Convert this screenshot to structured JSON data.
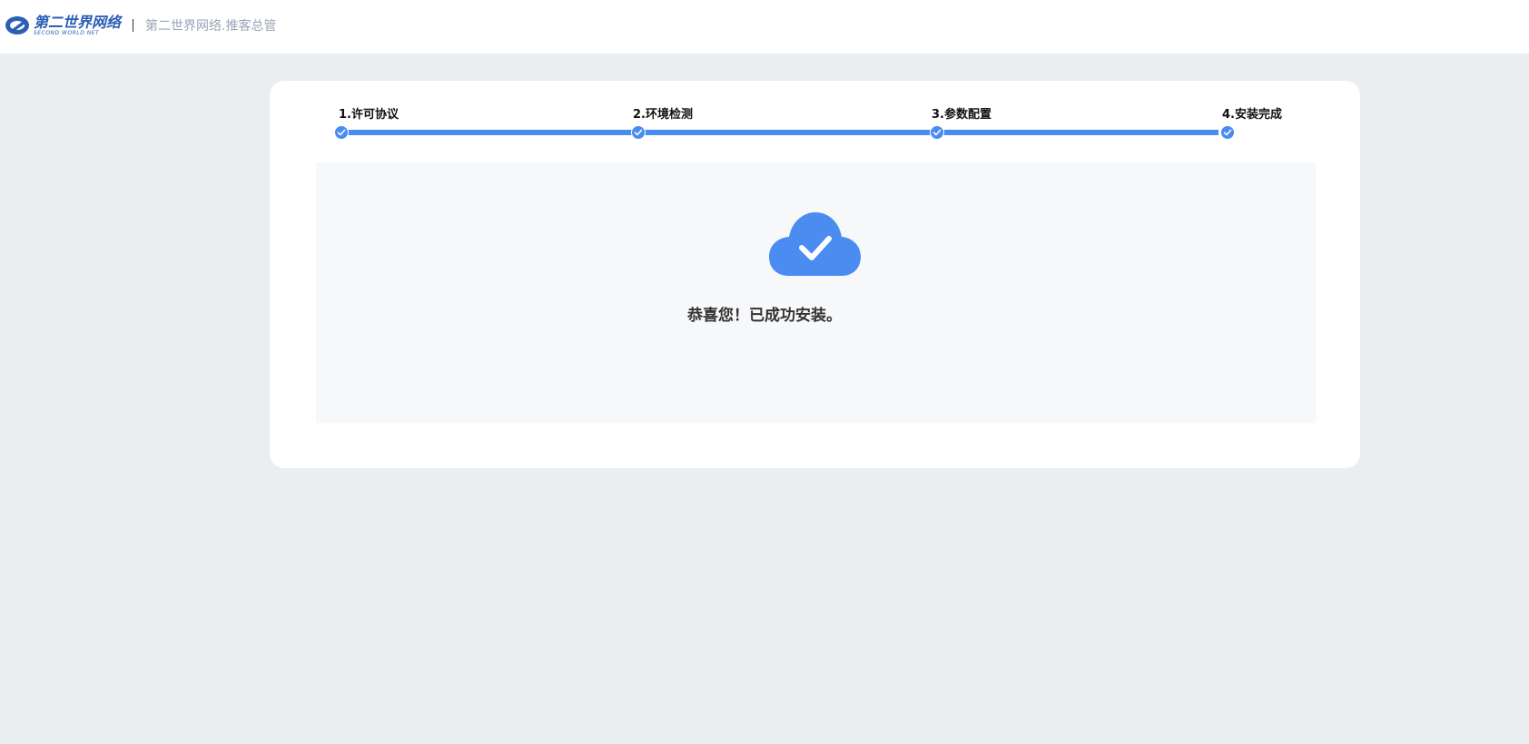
{
  "header": {
    "logo_cn": "第二世界网络",
    "logo_en": "SECOND WORLD NET",
    "app_name": "第二世界网络.推客总管"
  },
  "steps": [
    {
      "label": "1.许可协议",
      "done": true
    },
    {
      "label": "2.环境检测",
      "done": true
    },
    {
      "label": "3.参数配置",
      "done": true
    },
    {
      "label": "4.安装完成",
      "done": true
    }
  ],
  "result": {
    "icon": "cloud-check-icon",
    "message": "恭喜您！已成功安装。"
  },
  "colors": {
    "accent": "#4a8cf0",
    "page_bg": "#eaeef1",
    "panel_bg": "#f7f8fa"
  }
}
